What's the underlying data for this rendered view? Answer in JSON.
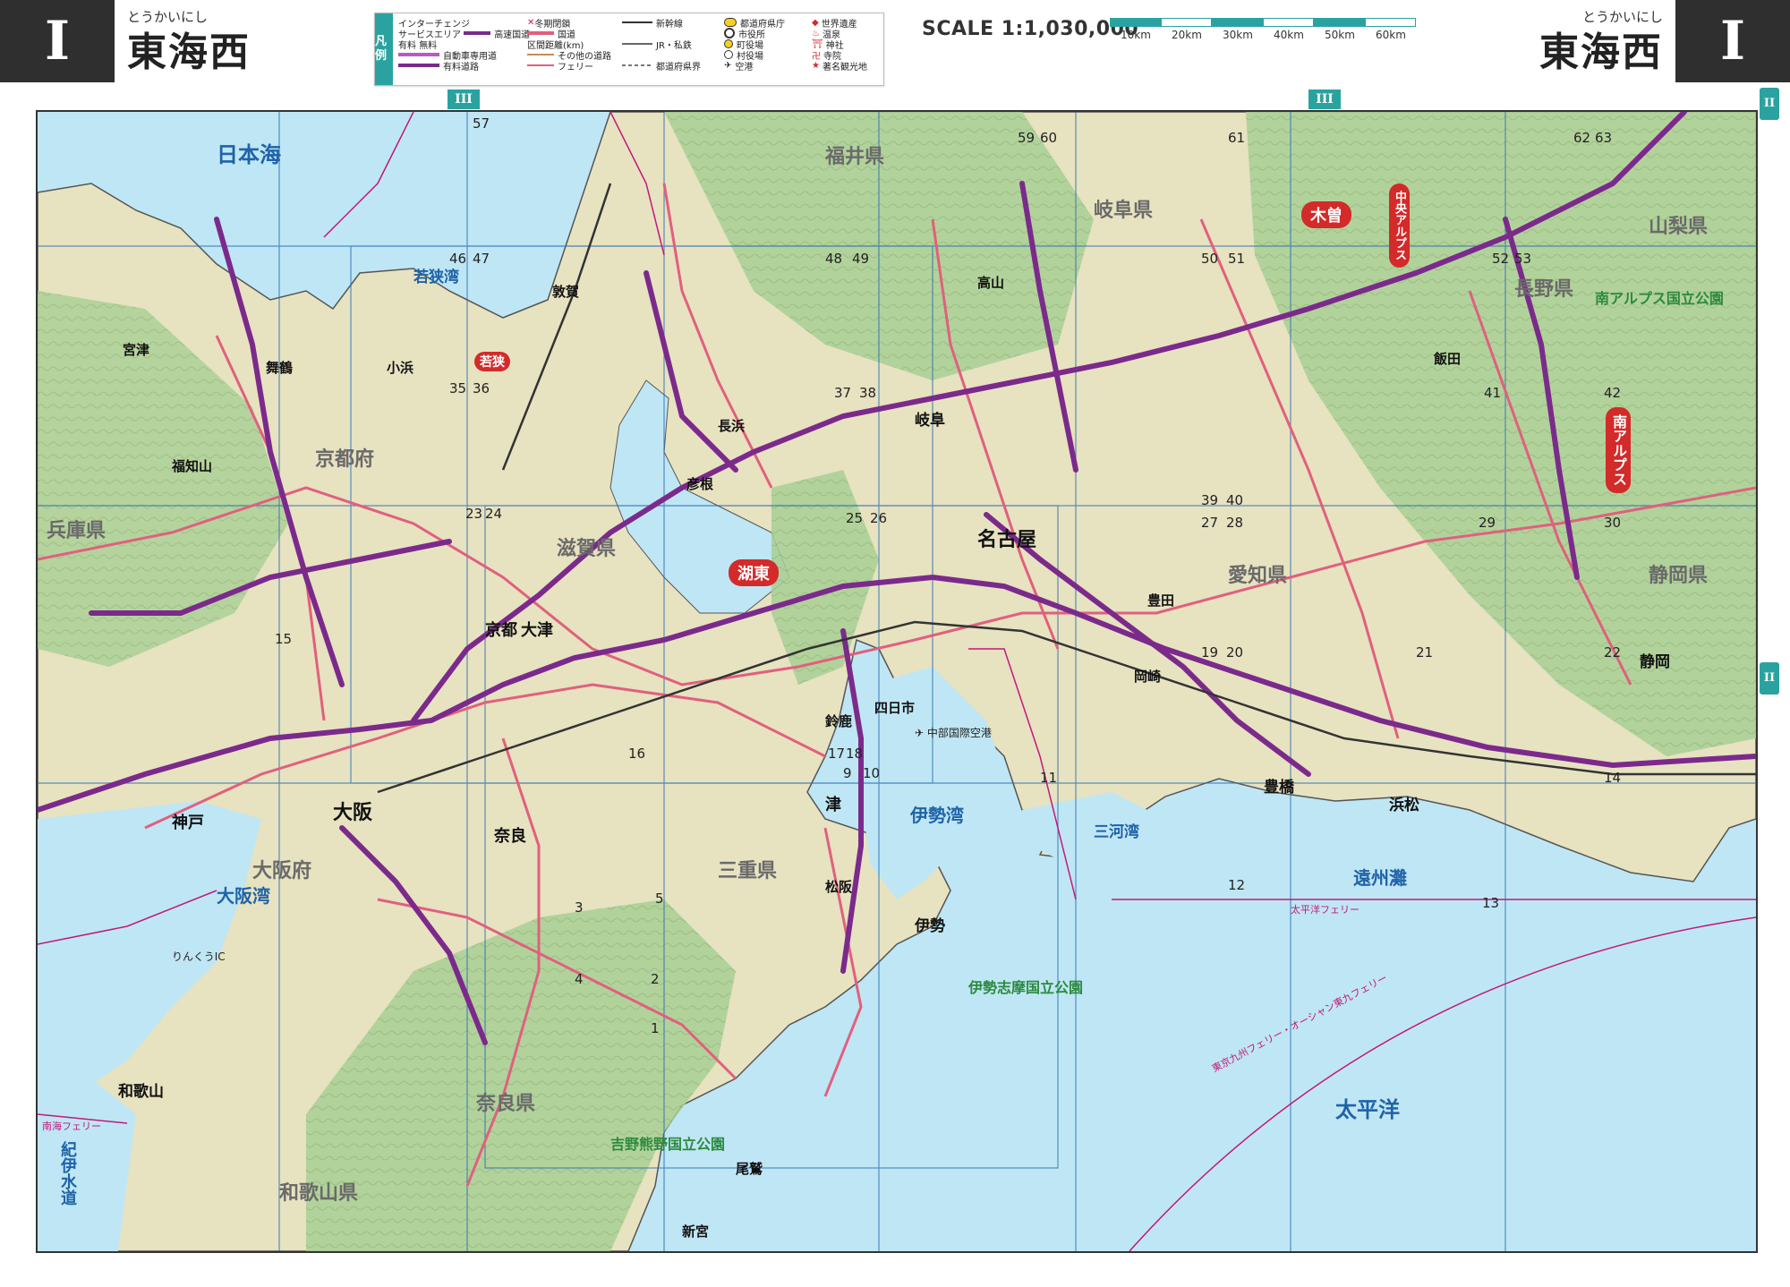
{
  "header": {
    "section": "I",
    "title": "東海西",
    "kana": "とうかいにし"
  },
  "legend": {
    "head": "凡例",
    "col1": [
      "インターチェンジ",
      "サービスエリア",
      "高速国道",
      "有料",
      "無料",
      "自動車専用道",
      "有料道路"
    ],
    "col2": [
      "冬期閉鎖",
      "国道",
      "区間距離(km)",
      "その他の道路",
      "フェリー"
    ],
    "col3": [
      "新幹線",
      "JR・私鉄",
      "都道府県界"
    ],
    "col4": [
      "都道府県庁",
      "市役所",
      "町役場",
      "村役場",
      "空港"
    ],
    "col5": [
      "世界遺産",
      "温泉",
      "神社",
      "寺院",
      "著名観光地"
    ]
  },
  "scale": {
    "text": "SCALE 1:1,030,000",
    "ticks": [
      "10km",
      "20km",
      "30km",
      "40km",
      "50km",
      "60km"
    ]
  },
  "markers": {
    "top": [
      "III",
      "III"
    ],
    "right": [
      "II",
      "II"
    ]
  },
  "colors": {
    "sea": "#bfe6f4",
    "land": "#e7e2c0",
    "forest": "#a9cf94",
    "expressway": "#7b2a8c",
    "national_road": "#e0607e",
    "accent": "#2aa3a0"
  },
  "map": {
    "seas": [
      "日本海",
      "若狭湾",
      "大阪湾",
      "伊勢湾",
      "三河湾",
      "遠州灘",
      "太平洋",
      "紀伊水道"
    ],
    "prefectures": [
      "福井県",
      "岐阜県",
      "長野県",
      "山梨県",
      "京都府",
      "滋賀県",
      "兵庫県",
      "愛知県",
      "静岡県",
      "三重県",
      "大阪府",
      "奈良県",
      "和歌山県"
    ],
    "cities": [
      "名古屋",
      "京都",
      "大津",
      "大阪",
      "神戸",
      "奈良",
      "津",
      "伊勢",
      "岐阜",
      "豊橋",
      "浜松",
      "静岡",
      "和歌山",
      "四日市",
      "彦根",
      "長浜",
      "舞鶴",
      "福知山",
      "高山",
      "飯田",
      "岡崎",
      "豊田",
      "鈴鹿",
      "松阪",
      "尾鷲",
      "新宮",
      "敦賀",
      "小浜",
      "宮津"
    ],
    "tags": [
      "湖東",
      "木曽",
      "若狭"
    ],
    "vtags": [
      "南アルプス",
      "中央アルプス"
    ],
    "parks": [
      "伊勢志摩国立公園",
      "吉野熊野国立公園",
      "南アルプス国立公園"
    ],
    "ferry_labels": [
      "太平洋フェリー",
      "東京九州フェリー・オーシャン東九フェリー",
      "南海フェリー"
    ],
    "page_refs": [
      "57",
      "46",
      "47",
      "48",
      "49",
      "50",
      "51",
      "52",
      "53",
      "59",
      "60",
      "61",
      "62",
      "63",
      "35",
      "36",
      "37",
      "38",
      "39",
      "40",
      "41",
      "42",
      "23",
      "24",
      "25",
      "26",
      "27",
      "28",
      "29",
      "30",
      "15",
      "16",
      "17",
      "18",
      "19",
      "20",
      "21",
      "22",
      "9",
      "10",
      "11",
      "12",
      "13",
      "14",
      "1",
      "2",
      "3",
      "4",
      "5"
    ],
    "airports": [
      "中部国際空港",
      "りんくうIC"
    ]
  }
}
